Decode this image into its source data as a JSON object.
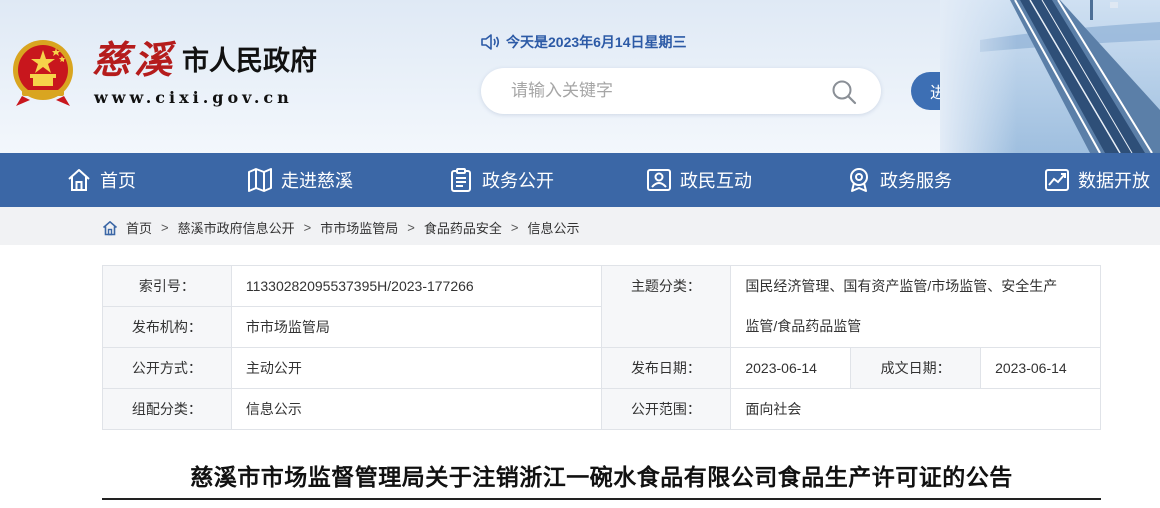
{
  "header": {
    "site_name": "慈溪",
    "site_suffix": "市人民政府",
    "site_url": "www.cixi.gov.cn",
    "date_text": "今天是2023年6月14日星期三",
    "search_placeholder": "请输入关键字",
    "elder_mode_label": "进入老年版",
    "brand_color": "#3b67a6",
    "title_color": "#b51c1c"
  },
  "nav": [
    {
      "label": "首页",
      "icon": "home-icon"
    },
    {
      "label": "走进慈溪",
      "icon": "map-icon"
    },
    {
      "label": "政务公开",
      "icon": "document-icon"
    },
    {
      "label": "政民互动",
      "icon": "interaction-icon"
    },
    {
      "label": "政务服务",
      "icon": "service-badge-icon"
    },
    {
      "label": "数据开放",
      "icon": "chart-icon"
    }
  ],
  "breadcrumb": [
    "首页",
    "慈溪市政府信息公开",
    "市市场监管局",
    "食品药品安全",
    "信息公示"
  ],
  "info": {
    "index_label": "索引号：",
    "index_value": "11330282095537395H/2023-177266",
    "topic_label": "主题分类：",
    "topic_value_line1": "国民经济管理、国有资产监管/市场监管、安全生产",
    "topic_value_line2": "监管/食品药品监管",
    "org_label": "发布机构：",
    "org_value": "市市场监管局",
    "method_label": "公开方式：",
    "method_value": "主动公开",
    "pubdate_label": "发布日期：",
    "pubdate_value": "2023-06-14",
    "docdate_label": "成文日期：",
    "docdate_value": "2023-06-14",
    "category_label": "组配分类：",
    "category_value": "信息公示",
    "scope_label": "公开范围：",
    "scope_value": "面向社会"
  },
  "article": {
    "title": "慈溪市市场监督管理局关于注销浙江一碗水食品有限公司食品生产许可证的公告"
  }
}
